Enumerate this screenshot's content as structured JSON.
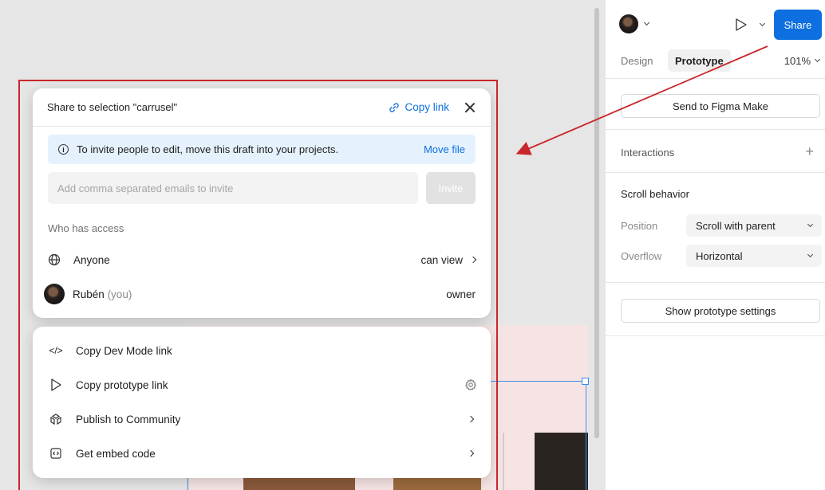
{
  "dialog": {
    "title": "Share to selection \"carrusel\"",
    "copy_link": "Copy link",
    "banner_text": "To invite people to edit, move this draft into your projects.",
    "banner_action": "Move file",
    "invite_placeholder": "Add comma separated emails to invite",
    "invite_button": "Invite",
    "who_has_access": "Who has access",
    "access": [
      {
        "name": "Anyone",
        "permission": "can view"
      },
      {
        "name": "Rubén",
        "suffix": "(you)",
        "permission": "owner"
      }
    ]
  },
  "menu": {
    "items": [
      {
        "label": "Copy Dev Mode link",
        "icon": "code-icon"
      },
      {
        "label": "Copy prototype link",
        "icon": "play-icon"
      },
      {
        "label": "Publish to Community",
        "icon": "community-icon"
      },
      {
        "label": "Get embed code",
        "icon": "embed-icon"
      }
    ]
  },
  "panel": {
    "share_button": "Share",
    "tabs": {
      "design": "Design",
      "prototype": "Prototype",
      "zoom": "101%"
    },
    "send_button": "Send to Figma Make",
    "interactions": "Interactions",
    "scroll_behavior": "Scroll behavior",
    "position_label": "Position",
    "position_value": "Scroll with parent",
    "overflow_label": "Overflow",
    "overflow_value": "Horizontal",
    "show_settings": "Show prototype settings"
  },
  "colors": {
    "accent": "#0d6fe0",
    "annotation_red": "#c9262c",
    "selection_blue": "#3d8be8"
  }
}
